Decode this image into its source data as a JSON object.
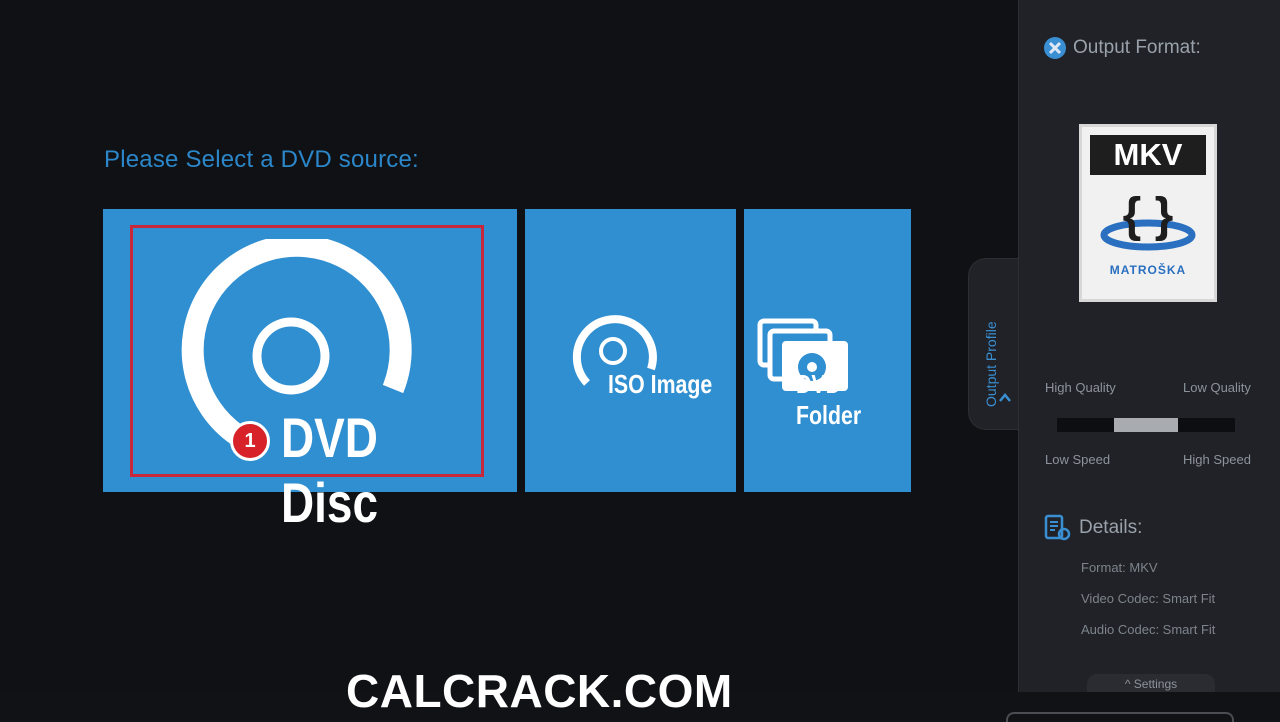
{
  "source": {
    "prompt": "Please Select a DVD source:",
    "options": [
      {
        "label": "DVD Disc",
        "badge": "1",
        "selected": true
      },
      {
        "label": "ISO Image"
      },
      {
        "label": "DVD Folder"
      }
    ]
  },
  "panel": {
    "output_format_title": "Output Format:",
    "format_card": {
      "title": "MKV",
      "brand": "MATROŠKA"
    },
    "side_tab": "Output Profile",
    "quality": {
      "high_quality": "High Quality",
      "low_quality": "Low Quality",
      "low_speed": "Low Speed",
      "high_speed": "High Speed",
      "level": 0.5
    },
    "details_title": "Details:",
    "details": [
      "Format: MKV",
      "Video Codec: Smart Fit",
      "Audio Codec: Smart Fit"
    ],
    "settings_label": "Settings"
  },
  "watermark": "CALCRACK.COM",
  "colors": {
    "tile_blue": "#2f8fd1",
    "accent_blue": "#2b87c9",
    "selection_red": "#c8283a"
  }
}
